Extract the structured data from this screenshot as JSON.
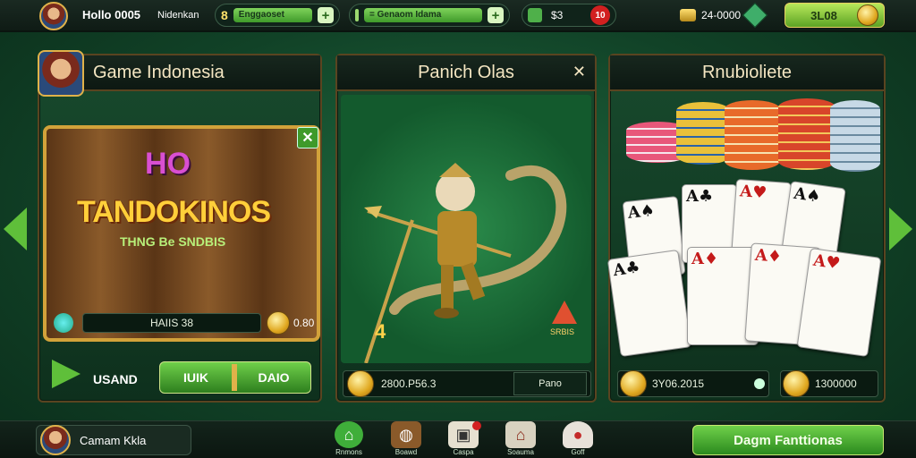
{
  "topbar": {
    "player_name": "Hollo 0005",
    "level_label": "Nidenkan",
    "level_value": "8",
    "xp_bar_label": "Enggaoset",
    "energy_bar_label": "= Genaom Idama",
    "messages_value": "$3",
    "messages_badge": "10",
    "coins_value": "24-0000",
    "shop_button_label": "3L08"
  },
  "panels": {
    "slots": {
      "title": "Game Indonesia",
      "logo_top": "HO",
      "logo_main": "TANDOKINOS",
      "logo_sub": "THNG Be SNDBIS",
      "bet_value": "HAIIS 38",
      "win_value": "0.80",
      "play_label": "USAND",
      "balance_label": "IUIK",
      "balance_value": "DAIO"
    },
    "featured": {
      "title": "Panich Olas",
      "bottom_value": "2800.P56.3",
      "bottom_right": "Pano",
      "badge_label": "SRBIS",
      "corner_number": "4"
    },
    "cards": {
      "title": "Rnubioliete",
      "value_left": "3Y06.2015",
      "value_right": "1300000"
    }
  },
  "footer": {
    "player_name": "Camam Kkla",
    "nav": [
      {
        "icon": "home-icon",
        "label": "Rnmons"
      },
      {
        "icon": "drum-icon",
        "label": "Boawd"
      },
      {
        "icon": "gift-icon",
        "label": "Caspa"
      },
      {
        "icon": "house-icon",
        "label": "Soauma"
      },
      {
        "icon": "mushroom-icon",
        "label": "Goff"
      }
    ],
    "cta_label": "Dagm Fanttionas"
  },
  "colors": {
    "accent_green": "#3f9a2a",
    "gold": "#e0a820",
    "panel_dark": "#0d1812"
  }
}
